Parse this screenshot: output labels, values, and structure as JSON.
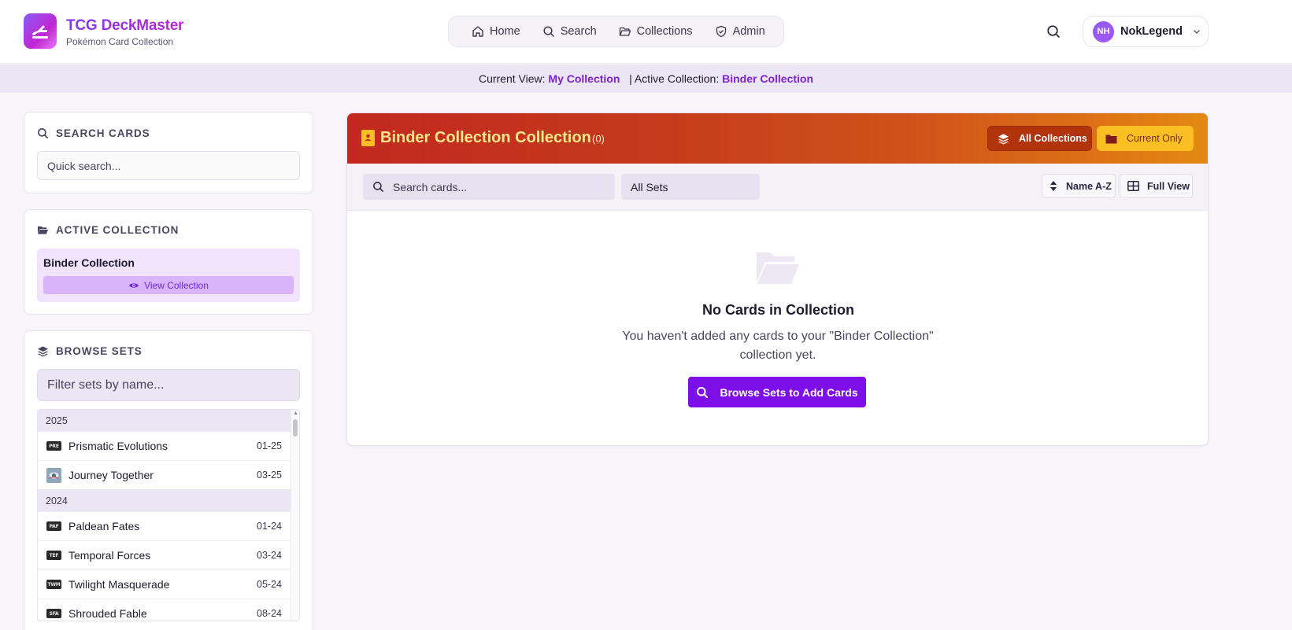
{
  "brand": {
    "title": "TCG DeckMaster",
    "subtitle": "Pokémon Card Collection"
  },
  "nav": {
    "home": "Home",
    "search": "Search",
    "collections": "Collections",
    "admin": "Admin"
  },
  "user": {
    "initials": "NH",
    "name": "NokLegend"
  },
  "status": {
    "view_label": "Current View:",
    "view_value": "My Collection",
    "active_label": "| Active Collection:",
    "active_value": "Binder Collection"
  },
  "sidebar": {
    "search_title": "SEARCH CARDS",
    "search_placeholder": "Quick search...",
    "active_title": "ACTIVE COLLECTION",
    "active_name": "Binder Collection",
    "view_button": "View Collection",
    "browse_title": "BROWSE SETS",
    "filter_placeholder": "Filter sets by name...",
    "groups": [
      {
        "year": "2025",
        "sets": [
          {
            "code": "PRE",
            "name": "Prismatic Evolutions",
            "date": "01-25"
          },
          {
            "code": "",
            "name": "Journey Together",
            "date": "03-25"
          }
        ]
      },
      {
        "year": "2024",
        "sets": [
          {
            "code": "PAF",
            "name": "Paldean Fates",
            "date": "01-24"
          },
          {
            "code": "TEF",
            "name": "Temporal Forces",
            "date": "03-24"
          },
          {
            "code": "TWM",
            "name": "Twilight Masquerade",
            "date": "05-24"
          },
          {
            "code": "SFA",
            "name": "Shrouded Fable",
            "date": "08-24"
          }
        ]
      }
    ]
  },
  "main": {
    "title": "Binder Collection Collection",
    "count": "(0)",
    "btn_all": "All Collections",
    "btn_current": "Current Only",
    "search_placeholder": "Search cards...",
    "sets_filter": "All Sets",
    "sort": "Name A-Z",
    "view_mode": "Full View",
    "empty_title": "No Cards in Collection",
    "empty_desc": "You haven't added any cards to your \"Binder Collection\" collection yet.",
    "browse_button": "Browse Sets to Add Cards"
  },
  "colors": {
    "accent": "#7e0ee8",
    "header_gradient_start": "#c2281f",
    "header_gradient_end": "#e38a12",
    "highlight": "#fbbf24"
  }
}
